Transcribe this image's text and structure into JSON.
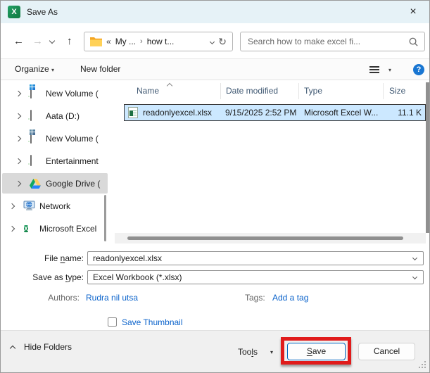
{
  "window": {
    "title": "Save As"
  },
  "icons": {
    "excel_letter": "X",
    "close": "×",
    "back": "←",
    "forward": "→",
    "up": "↑",
    "refresh": "↻",
    "collapsed": "«",
    "crumb_separator": "›",
    "dropdown_triangle": "▾",
    "help": "?"
  },
  "nav": {
    "breadcrumb": {
      "segment1": "My ...",
      "segment2": "how t..."
    },
    "search_placeholder": "Search how to make excel fi..."
  },
  "toolbar": {
    "organize_label": "Organize",
    "new_folder_label": "New folder"
  },
  "sidebar": {
    "items": [
      "New Volume (",
      "Aata (D:)",
      "New Volume (",
      "Entertainment",
      "Google Drive (",
      "Network",
      "Microsoft Excel"
    ],
    "selected_item": "Google Drive ("
  },
  "file_list": {
    "columns": [
      "Name",
      "Date modified",
      "Type",
      "Size"
    ],
    "rows": [
      {
        "name": "readonlyexcel.xlsx",
        "date_modified": "9/15/2025 2:52 PM",
        "type": "Microsoft Excel W...",
        "size": "11.1 K"
      }
    ]
  },
  "fields": {
    "file_name_label": {
      "pre": "File ",
      "mnemonic": "n",
      "post": "ame:"
    },
    "file_name_value": "readonlyexcel.xlsx",
    "save_as_type_label": {
      "pre": "Save as ",
      "mnemonic": "t",
      "post": "ype:"
    },
    "save_as_type_value": "Excel Workbook (*.xlsx)",
    "authors_label": "Authors:",
    "authors_value": "Rudra nil utsa",
    "tags_label": "Tags:",
    "add_tag_label": "Add a tag",
    "save_thumbnail_label": "Save Thumbnail"
  },
  "footer": {
    "hide_folders_label": "Hide Folders",
    "tools_label": {
      "pre": "Too",
      "mnemonic": "l",
      "post": "s"
    },
    "save_button": {
      "mnemonic": "S",
      "post": "ave"
    },
    "cancel_label": "Cancel"
  },
  "colors": {
    "titlebar_bg": "#e6f2f7",
    "selection_bg": "#cce8ff",
    "sidebar_selection_bg": "#d9d9d9",
    "link_blue": "#0b63cb",
    "accent_blue": "#0067c0",
    "annotation_red": "#e01b1b",
    "column_header_text": "#3f5872",
    "excel_green": "#107c41"
  }
}
